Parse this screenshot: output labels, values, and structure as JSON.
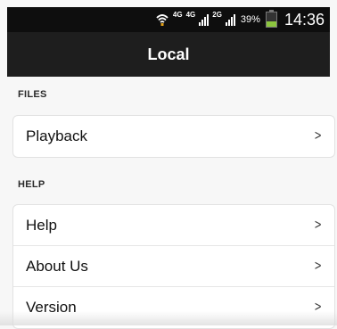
{
  "status_bar": {
    "wifi_icon": "wifi-icon",
    "net1": "4G",
    "net2": "4G",
    "net3": "2G",
    "battery_percent": "39%",
    "battery_level": 0.39,
    "time": "14:36"
  },
  "title_bar": {
    "title": "Local"
  },
  "sections": [
    {
      "header": "FILES",
      "items": [
        {
          "label": "Playback"
        }
      ]
    },
    {
      "header": "HELP",
      "items": [
        {
          "label": "Help"
        },
        {
          "label": "About Us"
        },
        {
          "label": "Version"
        }
      ]
    }
  ],
  "chevron": ">",
  "colors": {
    "title_bar_bg": "#1e1e1e",
    "status_bar_bg": "#0e0e0e",
    "battery": "#8cc63e"
  }
}
